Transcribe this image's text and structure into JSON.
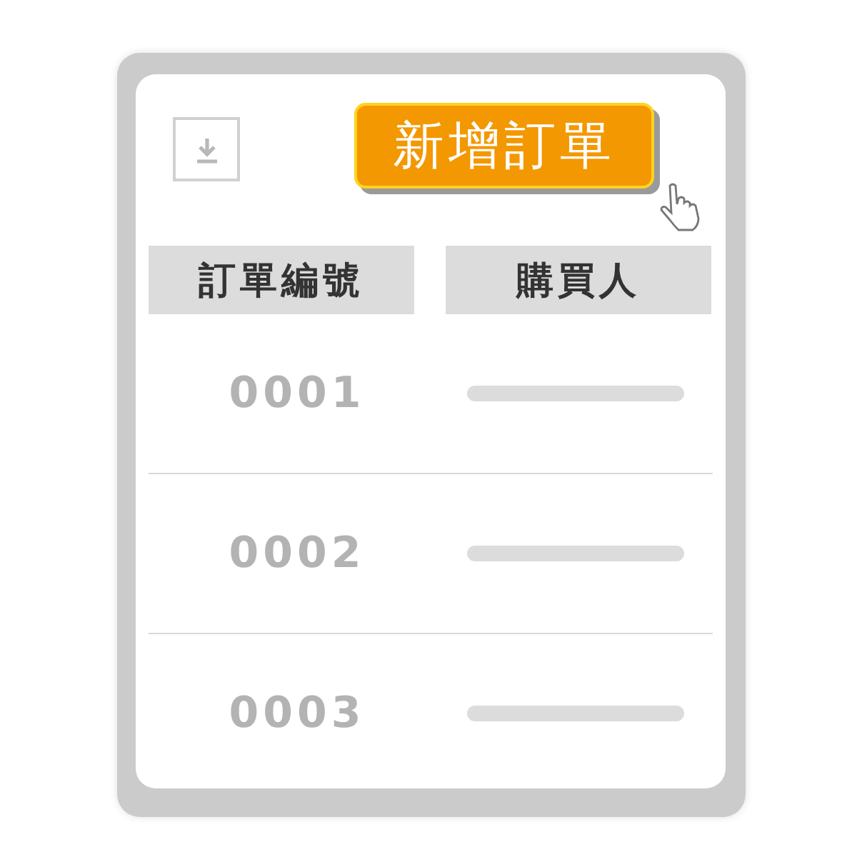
{
  "toolbar": {
    "add_button": "新增訂單"
  },
  "table": {
    "columns": [
      "訂單編號",
      "購買人"
    ],
    "rows": [
      {
        "order_number": "0001"
      },
      {
        "order_number": "0002"
      },
      {
        "order_number": "0003"
      }
    ]
  }
}
